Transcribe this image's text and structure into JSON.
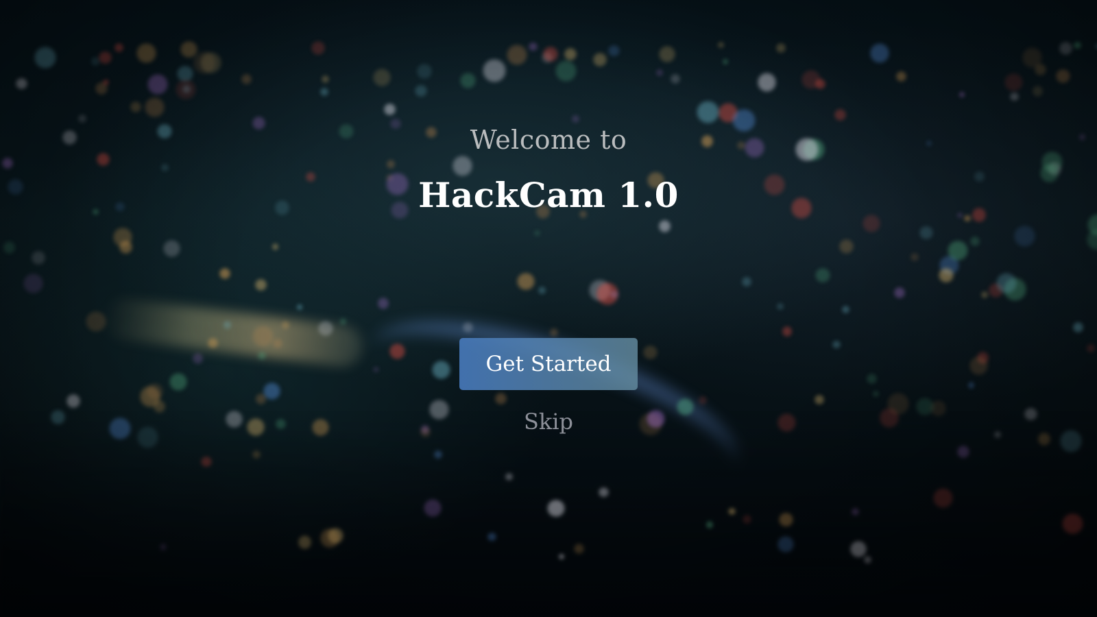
{
  "welcome": {
    "greeting": "Welcome to",
    "app_name": "HackCam 1.0"
  },
  "actions": {
    "primary_label": "Get Started",
    "secondary_label": "Skip"
  },
  "colors": {
    "primary_button": "#4f7fbf",
    "title_text": "#ffffff",
    "background": "#06131a"
  }
}
